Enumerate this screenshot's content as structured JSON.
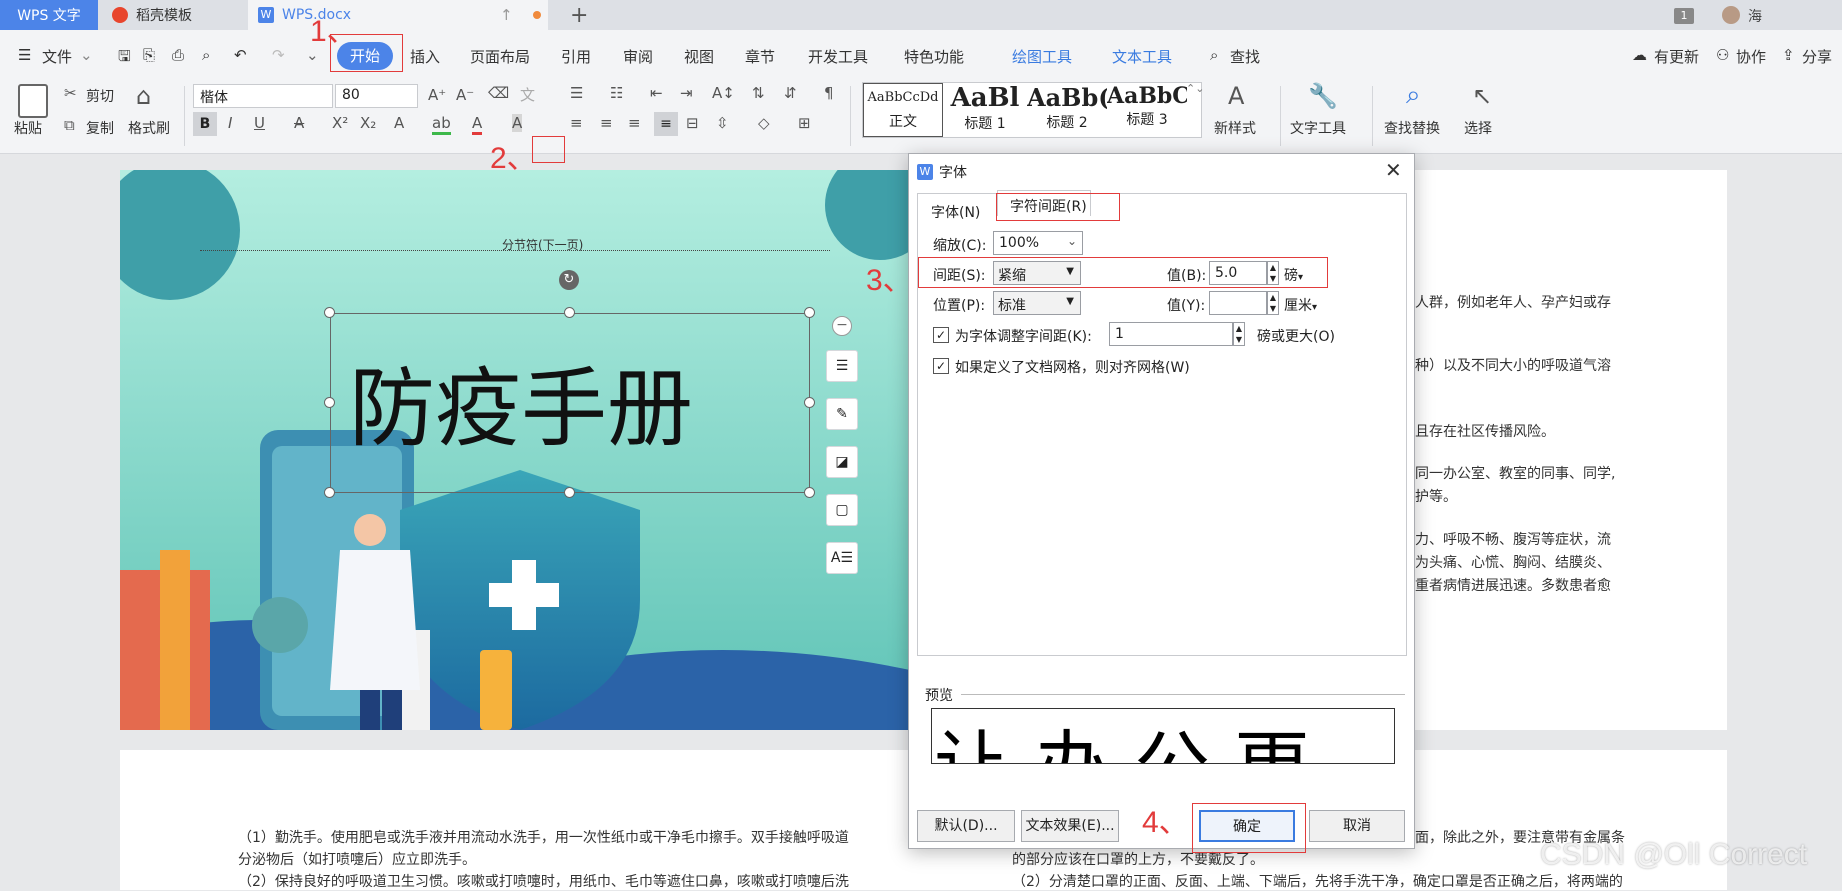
{
  "tabs": {
    "app": "WPS 文字",
    "template": "稻壳模板",
    "doc": "WPS.docx",
    "badge": "1",
    "user": "海"
  },
  "menu": {
    "file": "文件",
    "items": [
      "开始",
      "插入",
      "页面布局",
      "引用",
      "审阅",
      "视图",
      "章节",
      "开发工具",
      "特色功能",
      "绘图工具",
      "文本工具",
      "查找"
    ],
    "update": "有更新",
    "collab": "协作",
    "share": "分享"
  },
  "ribbon": {
    "paste": "粘贴",
    "cut": "剪切",
    "copy": "复制",
    "format_painter": "格式刷",
    "font_name": "楷体",
    "font_size": "80",
    "styles": [
      {
        "preview": "AaBbCcDd",
        "label": "正文"
      },
      {
        "preview": "AaBl",
        "label": "标题 1"
      },
      {
        "preview": "AaBb(",
        "label": "标题 2"
      },
      {
        "preview": "AaBbC",
        "label": "标题 3"
      }
    ],
    "new_style": "新样式",
    "text_tools": "文字工具",
    "find_replace": "查找替换",
    "select": "选择"
  },
  "annotations": [
    "1、",
    "2、",
    "3、",
    "4、"
  ],
  "document": {
    "section_break": "分节符(下一页)",
    "cover_title": "防疫手册",
    "right_lines": [
      "人群，例如老年人、孕产妇或存",
      "种）以及不同大小的呼吸道气溶",
      "且存在社区传播风险。",
      "同一办公室、教室的同事、同学,",
      "护等。",
      "力、呼吸不畅、腹泻等症状，流",
      "为头痛、心慌、胸闷、结膜炎、",
      "重者病情进展迅速。多数患者愈"
    ],
    "lower_left_lines": [
      "（1）勤洗手。使用肥皂或洗手液并用流动水洗手，用一次性纸巾或干净毛巾擦手。双手接触呼吸道",
      "分泌物后（如打喷嚏后）应立即洗手。",
      "（2）保持良好的呼吸道卫生习惯。咳嗽或打喷嚏时，用纸巾、毛巾等遮住口鼻，咳嗽或打喷嚏后洗"
    ],
    "lower_right_lines": [
      "面，除此之外，要注意带有金属条",
      "的部分应该在口罩的上方，不要戴反了。",
      "（2）分清楚口罩的正面、反面、上端、下端后，先将手洗干净，确定口罩是否正确之后，将两端的"
    ]
  },
  "dialog": {
    "title": "字体",
    "tab_font": "字体(N)",
    "tab_spacing": "字符间距(R)",
    "scale_label": "缩放(C):",
    "scale_value": "100%",
    "spacing_label": "间距(S):",
    "spacing_value": "紧缩",
    "value_b_label": "值(B):",
    "value_b": "5.0",
    "unit_b": "磅",
    "position_label": "位置(P):",
    "position_value": "标准",
    "value_y_label": "值(Y):",
    "unit_y": "厘米",
    "kerning_label": "为字体调整字间距(K):",
    "kerning_value": "1",
    "kerning_suffix": "磅或更大(O)",
    "grid_label": "如果定义了文档网格，则对齐网格(W)",
    "preview_label": "预览",
    "preview_text": "让办公更",
    "btn_default": "默认(D)...",
    "btn_effects": "文本效果(E)...",
    "btn_ok": "确定",
    "btn_cancel": "取消"
  },
  "watermark": "CSDN @Oll Correct"
}
